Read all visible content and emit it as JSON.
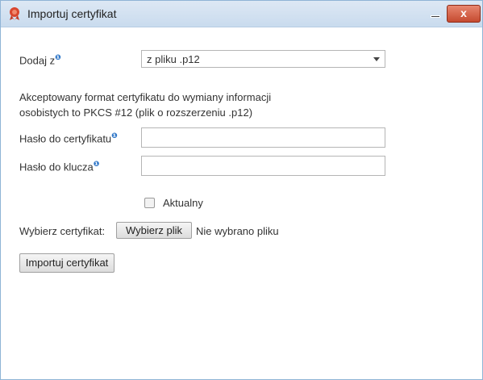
{
  "window": {
    "title": "Importuj certyfikat",
    "close_glyph": "x"
  },
  "form": {
    "source_label": "Dodaj z",
    "info_glyph": "❶",
    "source_select_value": "z pliku .p12",
    "description_line1": "Akceptowany format certyfikatu do wymiany informacji",
    "description_line2": "osobistych to PKCS #12 (plik o rozszerzeniu .p12)",
    "cert_password_label": "Hasło do certyfikatu",
    "key_password_label": "Hasło do klucza",
    "current_checkbox_label": "Aktualny",
    "choose_cert_label": "Wybierz certyfikat:",
    "choose_file_button": "Wybierz plik",
    "no_file_text": "Nie wybrano pliku",
    "import_button": "Importuj certyfikat"
  },
  "colors": {
    "titlebar": "#c9dbee",
    "close_button": "#c54a30",
    "info_icon": "#2f77c8",
    "window_border": "#8fb4d6"
  }
}
